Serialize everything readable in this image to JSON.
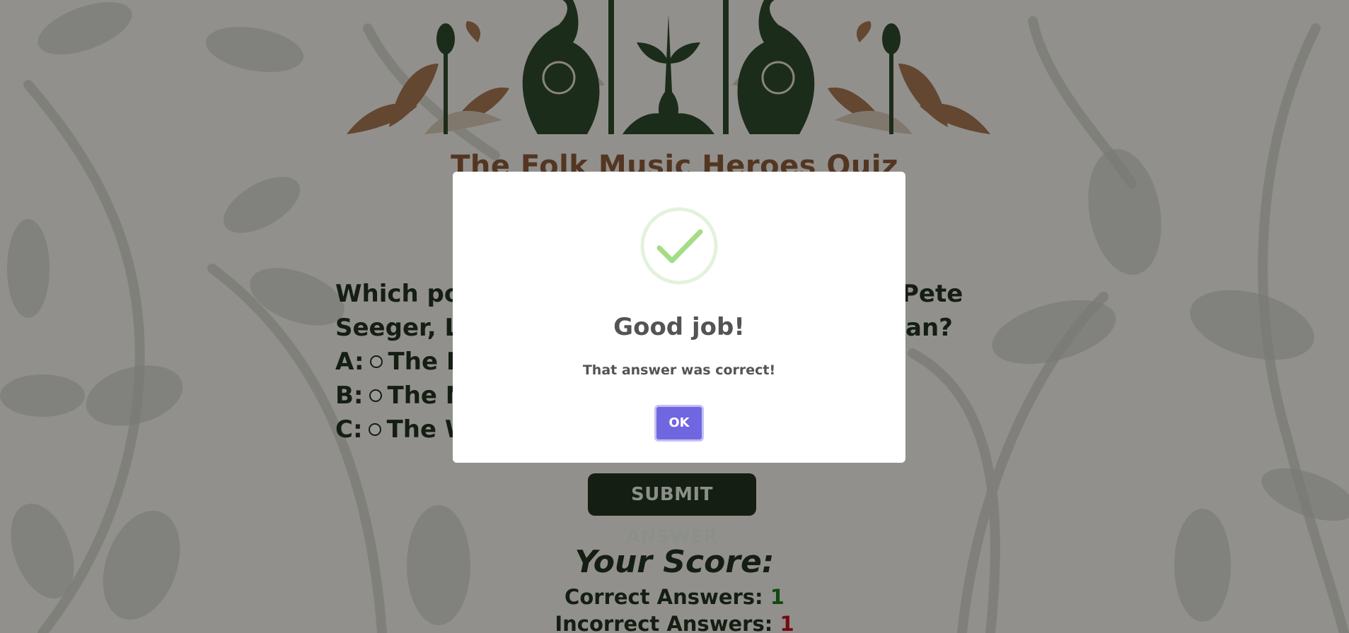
{
  "quiz": {
    "title": "The Folk Music Heroes Quiz",
    "question_lines": [
      "Which popu",
      "Seeger, Le",
      "Pete",
      "an?"
    ],
    "answers": [
      {
        "letter": "A:",
        "text": "The Lin"
      },
      {
        "letter": "B:",
        "text": "The Ne"
      },
      {
        "letter": "C:",
        "text": "The We"
      }
    ],
    "submit_label": "SUBMIT ANSWER"
  },
  "score": {
    "heading": "Your Score:",
    "correct_label": "Correct Answers:",
    "correct_value": "1",
    "incorrect_label": "Incorrect Answers:",
    "incorrect_value": "1"
  },
  "modal": {
    "icon": "success-check-icon",
    "title": "Good job!",
    "text": "That answer was correct!",
    "ok_label": "OK"
  },
  "colors": {
    "accent_dark_green": "#22331f",
    "title_brown": "#8a5a3a",
    "ok_button": "#7066e0",
    "success_green": "#a5dc86",
    "correct_green": "#1f7a1f",
    "incorrect_red": "#c0141a"
  }
}
